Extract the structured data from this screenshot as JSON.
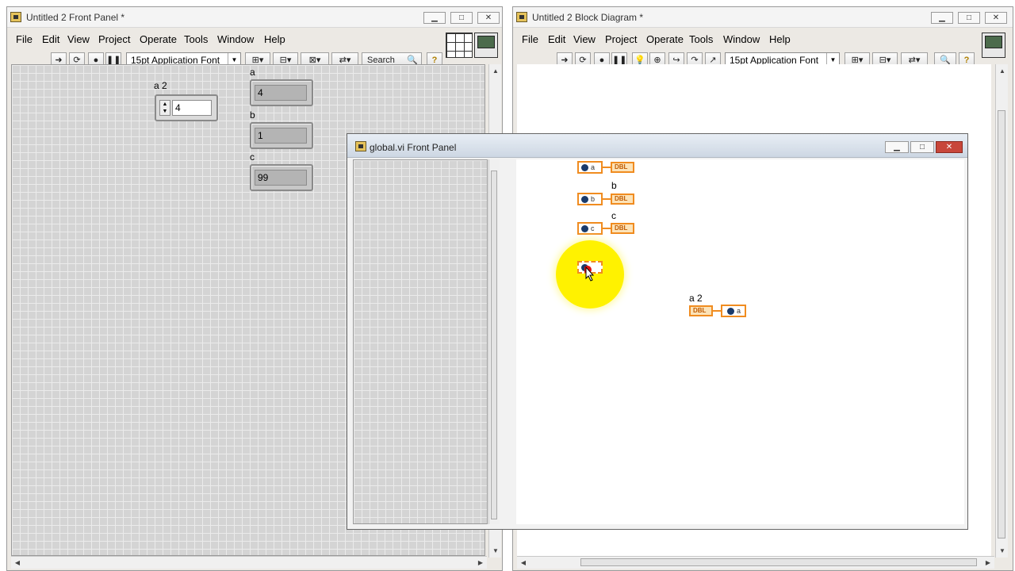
{
  "front_panel": {
    "title": "Untitled 2 Front Panel *",
    "menu": [
      "File",
      "Edit",
      "View",
      "Project",
      "Operate",
      "Tools",
      "Window",
      "Help"
    ],
    "font_label": "15pt Application Font",
    "search_label": "Search",
    "controls": {
      "a2": {
        "label": "a 2",
        "value": "4"
      },
      "a": {
        "label": "a",
        "value": "4"
      },
      "b": {
        "label": "b",
        "value": "1"
      },
      "c": {
        "label": "c",
        "value": "99"
      }
    }
  },
  "block_diagram": {
    "title": "Untitled 2 Block Diagram *",
    "menu": [
      "File",
      "Edit",
      "View",
      "Project",
      "Operate",
      "Tools",
      "Window",
      "Help"
    ],
    "font_label": "15pt Application Font",
    "nodes": {
      "b_label": "b",
      "c_label": "c",
      "a2_label": "a 2",
      "var_a": "a",
      "var_b": "b",
      "var_c": "c",
      "dbl": "DBL"
    }
  },
  "global_panel": {
    "title": "global.vi Front Panel"
  },
  "colors": {
    "wire_orange": "#f08c20",
    "highlight_yellow": "#fff200",
    "grid_gray": "#d4d4d4"
  }
}
